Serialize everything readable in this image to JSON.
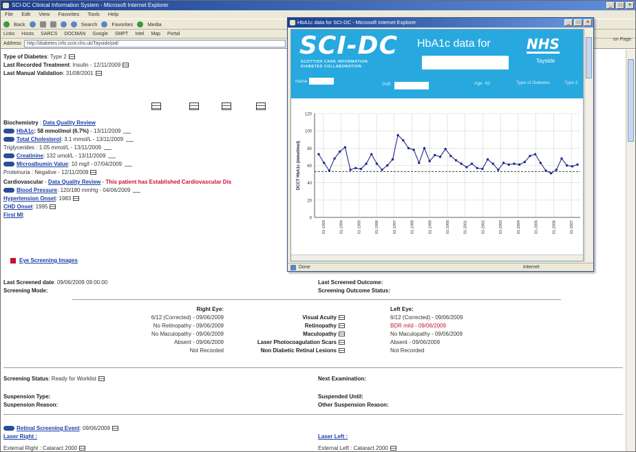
{
  "main_window": {
    "title": "SCI-DC Clinical Information System - Microsoft Internet Explorer",
    "menu": [
      "File",
      "Edit",
      "View",
      "Favorites",
      "Tools",
      "Help"
    ],
    "toolbar": [
      "Back",
      "Search",
      "Favorites",
      "Media"
    ],
    "links": [
      "Links",
      "Hosts",
      "SARCS",
      "DOCMAN",
      "Google",
      "SMPT",
      "Intel",
      "Map",
      "Portal"
    ],
    "address_label": "Address",
    "address_value": "http://diabetes.info.scot.nhs.uk/Tayside/pid/",
    "right_fragment": "on Page"
  },
  "patient": {
    "type_label": "Type of Diabetes",
    "type_value": ": Type 2",
    "treatment_label": "Last Recorded Treatment",
    "treatment_value": ": Insulin - 12/11/2009",
    "validation_label": "Last Manual Validation",
    "validation_value": ": 31/08/2001"
  },
  "biochem": {
    "heading": "Biochemistry",
    "review_link": "Data Quality Review",
    "hba1c_label": "HbA1c",
    "hba1c_value": ": 58 mmol/mol (6.7%)",
    "hba1c_date": " - 13/11/2009",
    "chol_label": "Total Cholesterol",
    "chol_value": ": 3.1 mmol/L - 13/11/2009",
    "trig": "Triglycerides : 1.05 mmol/L - 13/11/2009",
    "creat_label": "Creatinine",
    "creat_value": ": 132 umol/L - 13/11/2009",
    "micro_label": "Microalbumin Value",
    "micro_value": ": 10 mg/l - 07/04/2009",
    "protein": "Proteinuria : Negative - 12/11/2009"
  },
  "cardio": {
    "heading": "Cardiovascular",
    "review_link": "Data Quality Review",
    "warning": "This patient has Established Cardiovascular Dis",
    "bp_label": "Blood Pressure",
    "bp_value": ": 120/180 mmHg - 04/06/2009",
    "htn_label": "Hypertension Onset",
    "htn_value": ": 1983",
    "chd_label": "CHD Onset",
    "chd_value": ": 1995",
    "mi_label": "First MI",
    "mi_value": ":"
  },
  "eye": {
    "link": "Eye Screening Images",
    "last_screened_label": "Last Screened date",
    "last_screened_value": ": 09/06/2009 09:00:00",
    "mode_label": "Screening Mode:",
    "outcome_label": "Last Screened Outcome:",
    "outcome_status_label": "Screening Outcome Status:",
    "right_eye_header": "Right Eye:",
    "left_eye_header": "Left Eye:",
    "rows": [
      {
        "label": "Visual Acuity",
        "right": "6/12 (Corrected) - 09/06/2009",
        "left": "6/12 (Corrected) - 09/06/2009",
        "left_red": false
      },
      {
        "label": "Retinopathy",
        "right": "No Retinopathy - 09/06/2009",
        "left": "BDR mild - 09/06/2009",
        "left_red": true
      },
      {
        "label": "Maculopathy",
        "right": "No Maculopathy - 09/06/2009",
        "left": "No Maculopathy - 09/06/2009",
        "left_red": false
      },
      {
        "label": "Laser Photocoagulation Scars",
        "right": "Absent - 09/06/2009",
        "left": "Absent - 09/06/2009",
        "left_red": false
      },
      {
        "label": "Non Diabetic Retinal Lesions",
        "right": "Not Recorded",
        "left": "Not Recorded",
        "left_red": false
      }
    ],
    "status_label": "Screening Status",
    "status_value": ": Ready for Worklist",
    "next_exam_label": "Next Examination:",
    "suspension_type_label": "Suspension Type:",
    "suspension_reason_label": "Suspension Reason:",
    "suspended_until_label": "Suspended Until:",
    "other_reason_label": "Other Suspension Reason:",
    "retinal_event_link": "Retinal Screening Event",
    "retinal_event_value": ": 09/06/2009",
    "laser_right_label": "Laser Right :",
    "laser_left_label": "Laser Left :",
    "cutoff_right": "External Right : Cataract 2000",
    "cutoff_left": "External Left : Cataract 2000"
  },
  "popup": {
    "title": "HbA1c data for SCI-DC - Microsoft Internet Explorer",
    "logo": "SCI-DC",
    "logo_sub": "SCOTTISH CARE INFORMATION DIABETES COLLABORATION",
    "hba1c_title": "HbA1c data for",
    "nhs": "NHS",
    "nhs_sub": "Tayside",
    "field_name": "Name",
    "field_dob": "DoB",
    "field_age": "Age",
    "age_value": "62",
    "field_type": "Type of Diabetes",
    "type_value": "Type 2",
    "status_done": "Done",
    "status_zone": "Internet",
    "accent": "#27a9df"
  },
  "chart_data": {
    "type": "line",
    "ylabel": "DCCT HbA1c (mmol/mol)",
    "ylim": [
      0,
      120
    ],
    "yticks": [
      0,
      20,
      40,
      60,
      80,
      100,
      120
    ],
    "reference_line": 53,
    "xticks": [
      "01-1993",
      "01-1994",
      "01-1995",
      "01-1996",
      "01-1997",
      "01-1998",
      "01-1999",
      "01-2000",
      "01-2001",
      "01-2002",
      "01-2003",
      "01-2004",
      "01-2005",
      "01-2006",
      "01-2007"
    ],
    "series": [
      {
        "color": "#1f2a8c",
        "values": [
          73,
          63,
          54,
          68,
          76,
          81,
          55,
          57,
          56,
          62,
          73,
          62,
          55,
          60,
          67,
          95,
          89,
          80,
          78,
          63,
          80,
          65,
          72,
          70,
          79,
          71,
          66,
          62,
          58,
          62,
          57,
          56,
          67,
          62,
          55,
          63,
          61,
          62,
          61,
          64,
          71,
          73,
          63,
          54,
          51,
          55,
          68,
          60,
          59,
          61
        ]
      }
    ]
  }
}
